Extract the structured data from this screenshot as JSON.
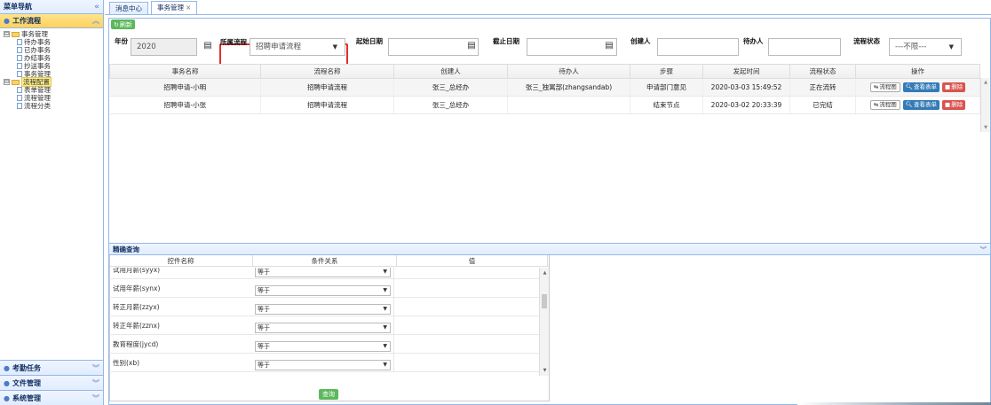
{
  "sidebar": {
    "title": "菜单导航",
    "collapse": "«",
    "active_section": "工作流程",
    "tree": [
      {
        "label": "事务管理",
        "toggle": "⊟",
        "kind": "folder",
        "children": [
          "待办事务",
          "已办事务",
          "办结事务",
          "抄送事务",
          "事务管理"
        ]
      },
      {
        "label": "流程配置",
        "toggle": "⊟",
        "kind": "folder",
        "selected": true,
        "children": [
          "表单管理",
          "流程管理",
          "流程分类"
        ]
      }
    ],
    "bottom_sections": [
      "考勤任务",
      "文件管理",
      "系统管理"
    ]
  },
  "tabs": [
    {
      "label": "消息中心"
    },
    {
      "label": "事务管理",
      "close": "×"
    }
  ],
  "toolbar": {
    "refresh_label": "刷新"
  },
  "search": {
    "year_label": "年份",
    "year_value": "2020",
    "process_label": "所属流程",
    "process_value": "招聘申请流程",
    "start_label": "起始日期",
    "end_label": "截止日期",
    "creator_label": "创建人",
    "handler_label": "待办人",
    "status_label": "流程状态",
    "status_value": "---不限---"
  },
  "grid": {
    "columns": [
      "事务名称",
      "流程名称",
      "创建人",
      "待办人",
      "步骤",
      "发起时间",
      "流程状态",
      "操作"
    ],
    "rows": [
      [
        "招聘申请-小明",
        "招聘申请流程",
        "张三_总经办",
        "张三_独寓部(zhangsandab)",
        "申请部门意见",
        "2020-03-03 15:49:52",
        "正在流转"
      ],
      [
        "招聘申请-小张",
        "招聘申请流程",
        "张三_总经办",
        "",
        "结束节点",
        "2020-03-02 20:33:39",
        "已完结"
      ]
    ],
    "actions": {
      "flow": "流程图",
      "view": "查看表单",
      "delete": "删除"
    }
  },
  "precise_query": {
    "title": "精确查询",
    "columns": [
      "控件名称",
      "条件关系",
      "值"
    ],
    "rows": [
      {
        "name": "试用月薪(syyx)",
        "op": "等于"
      },
      {
        "name": "试用年薪(synx)",
        "op": "等于"
      },
      {
        "name": "转正月薪(zzyx)",
        "op": "等于"
      },
      {
        "name": "转正年薪(zznx)",
        "op": "等于"
      },
      {
        "name": "教育程度(jycd)",
        "op": "等于"
      },
      {
        "name": "性别(xb)",
        "op": "等于"
      }
    ],
    "button": "查询"
  },
  "colors": {
    "accent": "#95b8e7",
    "highlight": "#e32d2d",
    "green": "#5cb85c",
    "blue": "#337ab7",
    "red": "#d9534f"
  }
}
